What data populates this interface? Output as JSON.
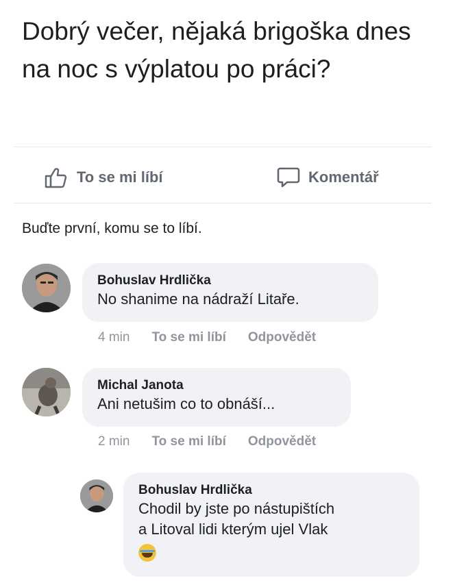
{
  "post": {
    "text": "Dobrý večer, nějaká brigoška dnes na noc s výplatou po práci?"
  },
  "actions": {
    "like_label": "To se mi líbí",
    "comment_label": "Komentář"
  },
  "likes_summary": "Buďte první, komu se to líbí.",
  "comments": [
    {
      "author": "Bohuslav Hrdlička",
      "text": "No shanime na nádraží Litaře.",
      "time": "4 min",
      "like_label": "To se mi líbí",
      "reply_label": "Odpovědět"
    },
    {
      "author": "Michal Janota",
      "text": "Ani netušim co to obnáší...",
      "time": "2 min",
      "like_label": "To se mi líbí",
      "reply_label": "Odpovědět"
    }
  ],
  "reply": {
    "author": "Bohuslav Hrdlička",
    "text_line1": "Chodil by jste po nástupištích",
    "text_line2": "a Litoval lidi kterým ujel Vlak",
    "emoji": "laughing-crying-emoji"
  }
}
